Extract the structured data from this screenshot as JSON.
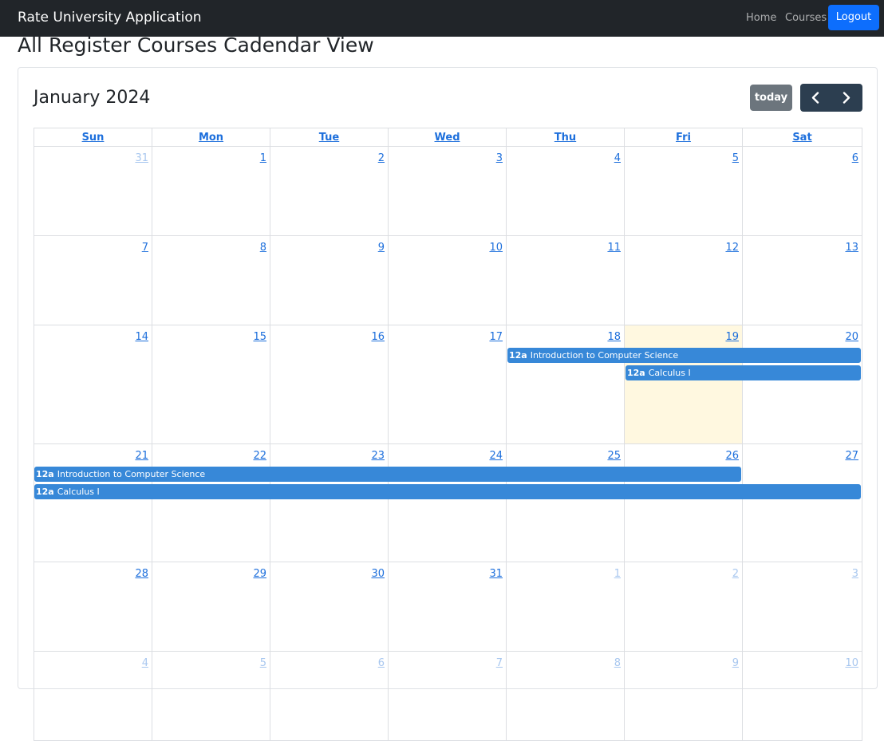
{
  "navbar": {
    "brand": "Rate University Application",
    "home": "Home",
    "courses": "Courses",
    "logout": "Logout"
  },
  "page": {
    "title": "All Register Courses Cadendar View"
  },
  "calendar": {
    "title": "January 2024",
    "today_label": "today",
    "weekdays": [
      "Sun",
      "Mon",
      "Tue",
      "Wed",
      "Thu",
      "Fri",
      "Sat"
    ],
    "weeks": [
      [
        {
          "d": "31",
          "other": true
        },
        {
          "d": "1"
        },
        {
          "d": "2"
        },
        {
          "d": "3"
        },
        {
          "d": "4"
        },
        {
          "d": "5"
        },
        {
          "d": "6"
        }
      ],
      [
        {
          "d": "7"
        },
        {
          "d": "8"
        },
        {
          "d": "9"
        },
        {
          "d": "10"
        },
        {
          "d": "11"
        },
        {
          "d": "12"
        },
        {
          "d": "13"
        }
      ],
      [
        {
          "d": "14"
        },
        {
          "d": "15"
        },
        {
          "d": "16"
        },
        {
          "d": "17"
        },
        {
          "d": "18"
        },
        {
          "d": "19",
          "today": true
        },
        {
          "d": "20"
        }
      ],
      [
        {
          "d": "21"
        },
        {
          "d": "22"
        },
        {
          "d": "23"
        },
        {
          "d": "24"
        },
        {
          "d": "25"
        },
        {
          "d": "26"
        },
        {
          "d": "27"
        }
      ],
      [
        {
          "d": "28"
        },
        {
          "d": "29"
        },
        {
          "d": "30"
        },
        {
          "d": "31"
        },
        {
          "d": "1",
          "other": true
        },
        {
          "d": "2",
          "other": true
        },
        {
          "d": "3",
          "other": true
        }
      ],
      [
        {
          "d": "4",
          "other": true
        },
        {
          "d": "5",
          "other": true
        },
        {
          "d": "6",
          "other": true
        },
        {
          "d": "7",
          "other": true
        },
        {
          "d": "8",
          "other": true
        },
        {
          "d": "9",
          "other": true
        },
        {
          "d": "10",
          "other": true
        }
      ]
    ],
    "events": [
      {
        "time": "12a",
        "title": "Introduction to Computer Science",
        "week": 2,
        "startCol": 4,
        "endCol": 6,
        "lane": 0
      },
      {
        "time": "12a",
        "title": "Calculus I",
        "week": 2,
        "startCol": 5,
        "endCol": 6,
        "lane": 1
      },
      {
        "time": "12a",
        "title": "Introduction to Computer Science",
        "week": 3,
        "startCol": 0,
        "endCol": 5,
        "lane": 0
      },
      {
        "time": "12a",
        "title": "Calculus I",
        "week": 3,
        "startCol": 0,
        "endCol": 6,
        "lane": 1
      }
    ]
  },
  "colors": {
    "navbar": "#212529",
    "logout": "#0d6efd",
    "event": "#3788d8",
    "today_bg": "#fff8e0",
    "nav_buttons": "#2c3e50"
  },
  "icons": {
    "prev": "chevron-left-icon",
    "next": "chevron-right-icon"
  }
}
